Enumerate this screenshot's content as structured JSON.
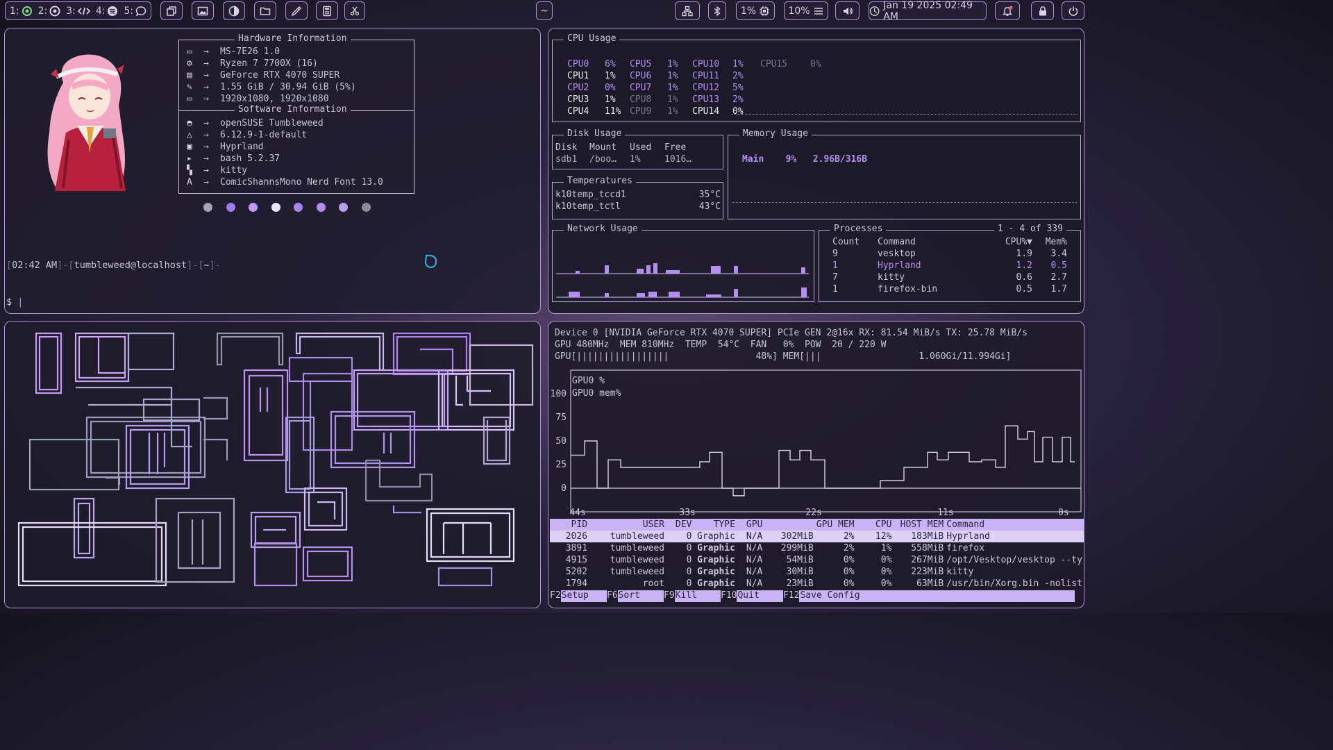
{
  "topbar": {
    "workspaces": [
      {
        "label": "1:",
        "icon": "circle-dot-icon"
      },
      {
        "label": "2:",
        "icon": "chrome-icon"
      },
      {
        "label": "3:",
        "icon": "code-icon"
      },
      {
        "label": "4:",
        "icon": "spotify-icon"
      },
      {
        "label": "5:",
        "icon": "chat-bubble-icon"
      }
    ],
    "center_label": "~",
    "cpu_percent": "1%",
    "mem_percent": "10%",
    "datetime": "Jan 19 2025 02:49 AM"
  },
  "fetch": {
    "hardware_title": "Hardware Information",
    "software_title": "Software Information",
    "hardware": [
      {
        "icon": "laptop-icon",
        "value": "MS-7E26 1.0"
      },
      {
        "icon": "cpu-icon",
        "value": "Ryzen 7 7700X (16)"
      },
      {
        "icon": "gpu-icon",
        "value": "GeForce RTX 4070 SUPER"
      },
      {
        "icon": "memory-icon",
        "value": "1.55 GiB / 30.94 GiB (5%)"
      },
      {
        "icon": "monitor-icon",
        "value": "1920x1080, 1920x1080"
      }
    ],
    "software": [
      {
        "icon": "chameleon-icon",
        "value": "openSUSE Tumbleweed"
      },
      {
        "icon": "linux-icon",
        "value": "6.12.9-1-default"
      },
      {
        "icon": "window-icon",
        "value": "Hyprland"
      },
      {
        "icon": "terminal-icon",
        "value": "bash 5.2.37"
      },
      {
        "icon": "kitty-icon",
        "value": "kitty"
      },
      {
        "icon": "font-icon",
        "value": "ComicShannsMono Nerd Font 13.0"
      }
    ],
    "arrow": "→",
    "palette": [
      "#a9a3b8",
      "#9d7ee8",
      "#c49af2",
      "#ece4ff",
      "#a884f0",
      "#b68cf3",
      "#b79ff0",
      "#8f8a9c"
    ],
    "prompt_time": "02:42 AM",
    "prompt_user": "tumbleweed",
    "prompt_at": "@",
    "prompt_host": "localhost",
    "prompt_dir": "~",
    "prompt_symbol": "$"
  },
  "btop": {
    "cpu_title": "CPU Usage",
    "cpu_cells": [
      {
        "name": "CPU0",
        "pct": "6%"
      },
      {
        "name": "CPU5",
        "pct": "1%"
      },
      {
        "name": "CPU10",
        "pct": "1%"
      },
      {
        "name": "CPU15",
        "pct": "0%"
      },
      {
        "name": "CPU1",
        "pct": "1%"
      },
      {
        "name": "CPU6",
        "pct": "1%"
      },
      {
        "name": "CPU11",
        "pct": "2%"
      },
      {
        "name": "CPU2",
        "pct": "0%"
      },
      {
        "name": "CPU7",
        "pct": "1%"
      },
      {
        "name": "CPU12",
        "pct": "5%"
      },
      {
        "name": "CPU3",
        "pct": "1%"
      },
      {
        "name": "CPU8",
        "pct": "1%"
      },
      {
        "name": "CPU13",
        "pct": "2%"
      },
      {
        "name": "CPU4",
        "pct": "11%"
      },
      {
        "name": "CPU9",
        "pct": "1%"
      },
      {
        "name": "CPU14",
        "pct": "0%"
      }
    ],
    "disk_title": "Disk Usage",
    "disk_headers": [
      "Disk",
      "Mount",
      "Used",
      "Free"
    ],
    "disk_row": [
      "sdb1",
      "/boo…",
      "1%",
      "1016…"
    ],
    "mem_title": "Memory Usage",
    "mem_label": "Main",
    "mem_pct": "9%",
    "mem_amount": "2.96B/316B",
    "temp_title": "Temperatures",
    "temps": [
      {
        "name": "k10temp_tccd1",
        "value": "35°C"
      },
      {
        "name": "k10temp_tctl",
        "value": "43°C"
      }
    ],
    "net_title": "Network Usage",
    "proc_title": "Processes",
    "proc_range": "1 - 4 of 339",
    "proc_headers": [
      "Count",
      "Command",
      "CPU%▼",
      "Mem%"
    ],
    "procs": [
      {
        "count": "9",
        "cmd": "vesktop",
        "cpu": "1.9",
        "mem": "3.4"
      },
      {
        "count": "1",
        "cmd": "Hyprland",
        "cpu": "1.2",
        "mem": "0.5"
      },
      {
        "count": "7",
        "cmd": "kitty",
        "cpu": "0.6",
        "mem": "2.7"
      },
      {
        "count": "1",
        "cmd": "firefox-bin",
        "cpu": "0.5",
        "mem": "1.7"
      }
    ]
  },
  "nvtop": {
    "device_line": "Device 0 [NVIDIA GeForce RTX 4070 SUPER] PCIe GEN 2@16x RX: 81.54 MiB/s TX: 25.78 MiB/s",
    "clock_line": "GPU 480MHz  MEM 810MHz  TEMP  54°C  FAN   0%  POW  20 / 220 W",
    "bar_line": "GPU[|||||||||||||||||                48%] MEM[|||                  1.060Gi/11.994Gi]",
    "legend_gpu": "GPU0 %",
    "legend_mem": "GPU0 mem%",
    "yticks": [
      "100",
      "75",
      "50",
      "25",
      "0"
    ],
    "xticks": [
      "44s",
      "33s",
      "22s",
      "11s",
      "0s"
    ],
    "table_headers": [
      "PID",
      "USER",
      "DEV",
      "TYPE",
      "GPU",
      "GPU MEM",
      "CPU",
      "HOST MEM",
      "Command"
    ],
    "rows": [
      [
        "2026",
        "tumbleweed",
        "0",
        "Graphic",
        "N/A",
        "302MiB",
        "2%",
        "12%",
        "183MiB",
        "Hyprland"
      ],
      [
        "3891",
        "tumbleweed",
        "0",
        "Graphic",
        "N/A",
        "299MiB",
        "2%",
        "1%",
        "558MiB",
        "firefox"
      ],
      [
        "4915",
        "tumbleweed",
        "0",
        "Graphic",
        "N/A",
        "54MiB",
        "0%",
        "0%",
        "267MiB",
        "/opt/Vesktop/vesktop --ty"
      ],
      [
        "5202",
        "tumbleweed",
        "0",
        "Graphic",
        "N/A",
        "30MiB",
        "0%",
        "0%",
        "223MiB",
        "kitty"
      ],
      [
        "1794",
        "root",
        "0",
        "Graphic",
        "N/A",
        "23MiB",
        "0%",
        "0%",
        "63MiB",
        "/usr/bin/Xorg.bin -nolist"
      ]
    ],
    "fkeys": [
      {
        "key": "F2",
        "label": "Setup"
      },
      {
        "key": "F6",
        "label": "Sort"
      },
      {
        "key": "F9",
        "label": "Kill"
      },
      {
        "key": "F10",
        "label": "Quit"
      },
      {
        "key": "F12",
        "label": "Save Config"
      }
    ]
  }
}
